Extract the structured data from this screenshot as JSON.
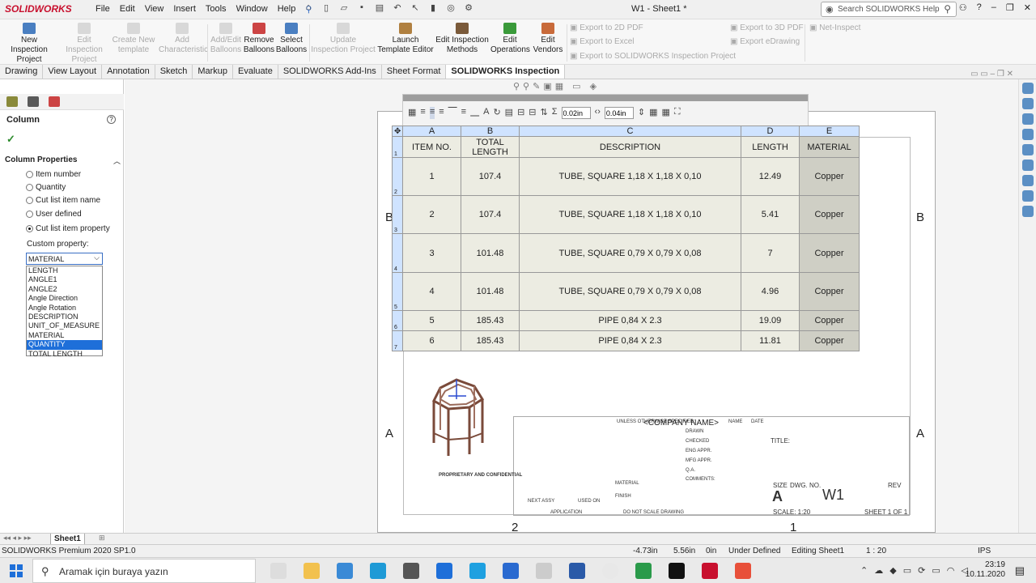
{
  "app": {
    "logo": "SOLIDWORKS",
    "window_title": "W1 - Sheet1 *",
    "search_placeholder": "Search SOLIDWORKS Help"
  },
  "menu": [
    "File",
    "Edit",
    "View",
    "Insert",
    "Tools",
    "Window",
    "Help"
  ],
  "ribbon": {
    "buttons": [
      {
        "label": "New Inspection Project",
        "enabled": true
      },
      {
        "label": "Edit Inspection Project",
        "enabled": false
      },
      {
        "label": "Create New template",
        "enabled": false
      },
      {
        "label": "Add Characteristic",
        "enabled": false
      },
      {
        "label": "Add/Edit Balloons",
        "enabled": false
      },
      {
        "label": "Remove Balloons",
        "enabled": true
      },
      {
        "label": "Select Balloons",
        "enabled": true
      },
      {
        "label": "Update Inspection Project",
        "enabled": false
      },
      {
        "label": "Launch Template Editor",
        "enabled": true
      },
      {
        "label": "Edit Inspection Methods",
        "enabled": true
      },
      {
        "label": "Edit Operations",
        "enabled": true
      },
      {
        "label": "Edit Vendors",
        "enabled": true
      }
    ],
    "small": [
      "Export to 2D PDF",
      "Export to Excel",
      "Export to SOLIDWORKS Inspection Project",
      "Export to 3D PDF",
      "Export eDrawing",
      "Net-Inspect"
    ]
  },
  "tabs": [
    "Drawing",
    "View Layout",
    "Annotation",
    "Sketch",
    "Markup",
    "Evaluate",
    "SOLIDWORKS Add-Ins",
    "Sheet Format",
    "SOLIDWORKS Inspection"
  ],
  "active_tab": "SOLIDWORKS Inspection",
  "panel": {
    "title": "Column",
    "section": "Column Properties",
    "radios": [
      "Item number",
      "Quantity",
      "Cut list item name",
      "User defined",
      "Cut list item property"
    ],
    "selected_radio": "Cut list item property",
    "custom_label": "Custom property:",
    "select_value": "MATERIAL",
    "options": [
      "LENGTH",
      "ANGLE1",
      "ANGLE2",
      "Angle Direction",
      "Angle Rotation",
      "DESCRIPTION",
      "UNIT_OF_MEASURE",
      "MATERIAL",
      "QUANTITY",
      "TOTAL LENGTH"
    ],
    "highlighted_option": "QUANTITY"
  },
  "format_toolbar": {
    "width1": "0.02in",
    "width2": "0.04in"
  },
  "table": {
    "col_letters": [
      "A",
      "B",
      "C",
      "D",
      "E"
    ],
    "headers": [
      "ITEM NO.",
      "TOTAL LENGTH",
      "DESCRIPTION",
      "LENGTH",
      "MATERIAL"
    ],
    "rows": [
      [
        "1",
        "107.4",
        "TUBE, SQUARE 1,18 X 1,18 X 0,10",
        "12.49",
        "Copper"
      ],
      [
        "2",
        "107.4",
        "TUBE, SQUARE 1,18 X 1,18 X 0,10",
        "5.41",
        "Copper"
      ],
      [
        "3",
        "101.48",
        "TUBE, SQUARE 0,79 X 0,79 X 0,08",
        "7",
        "Copper"
      ],
      [
        "4",
        "101.48",
        "TUBE, SQUARE 0,79 X 0,79 X 0,08",
        "4.96",
        "Copper"
      ],
      [
        "5",
        "185.43",
        "PIPE 0,84 X 2.3",
        "19.09",
        "Copper"
      ],
      [
        "6",
        "185.43",
        "PIPE 0,84 X 2.3",
        "11.81",
        "Copper"
      ]
    ],
    "row_numbers": [
      "1",
      "2",
      "3",
      "4",
      "5",
      "6",
      "7"
    ]
  },
  "sheet": {
    "zones": {
      "b": "B",
      "a": "A",
      "n2": "2",
      "n1": "1"
    },
    "company": "<COMPANY NAME>",
    "title_label": "TITLE:",
    "size_label": "SIZE",
    "dwg_label": "DWG.  NO.",
    "rev_label": "REV",
    "size": "A",
    "dwg_no": "W1",
    "scale": "SCALE: 1:20",
    "sheet_of": "SHEET 1 OF 1",
    "tb_lines": [
      "UNLESS OTHERWISE SPECIFIED:",
      "NAME",
      "DATE",
      "DRAWN",
      "CHECKED",
      "ENG APPR.",
      "MFG APPR.",
      "Q.A.",
      "COMMENTS:",
      "PROPRIETARY AND CONFIDENTIAL",
      "APPLICATION",
      "DO NOT SCALE DRAWING",
      "NEXT ASSY",
      "USED ON",
      "FINISH",
      "MATERIAL"
    ]
  },
  "sheet_tab": "Sheet1",
  "statusbar": {
    "product": "SOLIDWORKS Premium 2020 SP1.0",
    "x": "-4.73in",
    "y": "5.56in",
    "z": "0in",
    "def": "Under Defined",
    "editing": "Editing Sheet1",
    "scale": "1 : 20",
    "units": "IPS"
  },
  "taskbar": {
    "search": "Aramak için buraya yazın",
    "time": "23:19",
    "date": "10.11.2020"
  }
}
